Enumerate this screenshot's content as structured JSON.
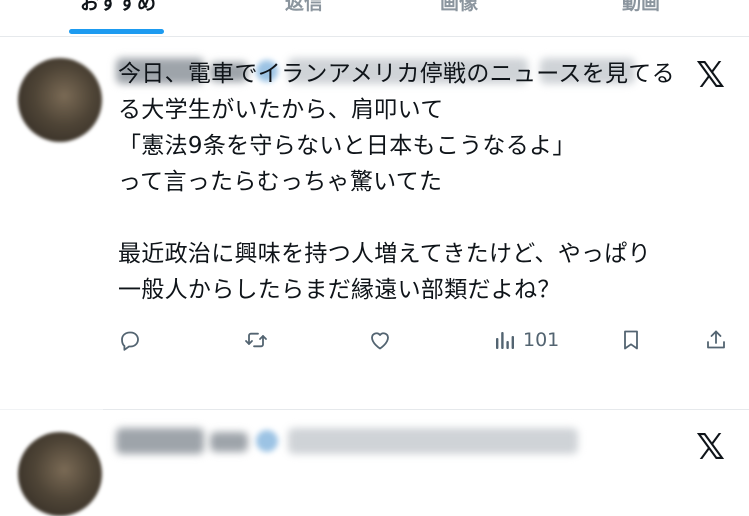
{
  "tabs": [
    {
      "label": "おすすめ",
      "active": true
    },
    {
      "label": "返信",
      "active": false
    },
    {
      "label": "画像",
      "active": false
    },
    {
      "label": "動画",
      "active": false
    }
  ],
  "tweet": {
    "lines": [
      "今日、電車でイランアメリカ停戦のニュースを見てる",
      "る大学生がいたから、肩叩いて",
      "「憲法9条を守らないと日本もこうなるよ」",
      "って言ったらむっちゃ驚いてた",
      "",
      "最近政治に興味を持つ人増えてきたけど、やっぱり",
      "一般人からしたらまだ縁遠い部類だよね？"
    ],
    "logo": "𝕏",
    "actions": {
      "reply_icon": "reply-icon",
      "retweet_icon": "retweet-icon",
      "like_icon": "heart-icon",
      "views_icon": "views-icon",
      "views_count": "101",
      "bookmark_icon": "bookmark-icon",
      "share_icon": "share-icon"
    }
  },
  "next_tweet": {
    "logo": "𝕏"
  },
  "colors": {
    "accent": "#1d9bf0",
    "text": "#0f1419",
    "muted": "#536471",
    "rail": "#f1f3f5"
  }
}
